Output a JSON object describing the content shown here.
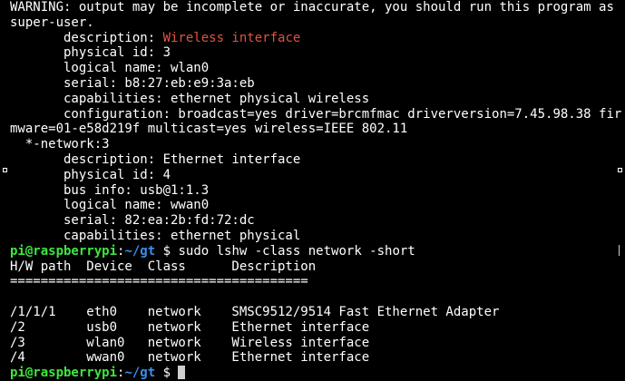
{
  "terminal": {
    "colors": {
      "background": "#000000",
      "text": "#ffffff",
      "highlight": "#e0553e",
      "user": "#3fe63f",
      "path": "#3b8fe8"
    },
    "output_top": {
      "warning_1": "WARNING: output may be incomplete or inaccurate, you should run this program as",
      "warning_2": "super-user.",
      "desc_label": "       description: ",
      "desc_value": "Wireless interface",
      "line_physid": "       physical id: 3",
      "line_logical": "       logical name: wlan0",
      "line_serial": "       serial: b8:27:eb:e9:3a:eb",
      "line_caps": "       capabilities: ethernet physical wireless",
      "line_config_1": "       configuration: broadcast=yes driver=brcmfmac driverversion=7.45.98.38 fir",
      "line_config_2": "mware=01-e58d219f multicast=yes wireless=IEEE 802.11",
      "line_network": "  *-network:3",
      "line_desc2": "       description: Ethernet interface",
      "line_physid2": "       physical id: 4",
      "line_bus": "       bus info: usb@1:1.3",
      "line_logical2": "       logical name: wwan0",
      "line_serial2": "       serial: 82:ea:2b:fd:72:dc",
      "line_caps2": "       capabilities: ethernet physical"
    },
    "prompt": {
      "user_host": "pi@raspberrypi",
      "separator": ":",
      "path": "~/gt",
      "symbol": " $ ",
      "command": "sudo lshw -class network -short"
    },
    "table": {
      "header": "H/W path  Device  Class      Description",
      "rule": "=======================================",
      "blank": " ",
      "rows": [
        "/1/1/1    eth0    network    SMSC9512/9514 Fast Ethernet Adapter",
        "/2        usb0    network    Ethernet interface",
        "/3        wlan0   network    Wireless interface",
        "/4        wwan0   network    Ethernet interface"
      ]
    },
    "prompt_final": {
      "user_host": "pi@raspberrypi",
      "separator": ":",
      "path": "~/gt",
      "symbol": " $ "
    }
  }
}
